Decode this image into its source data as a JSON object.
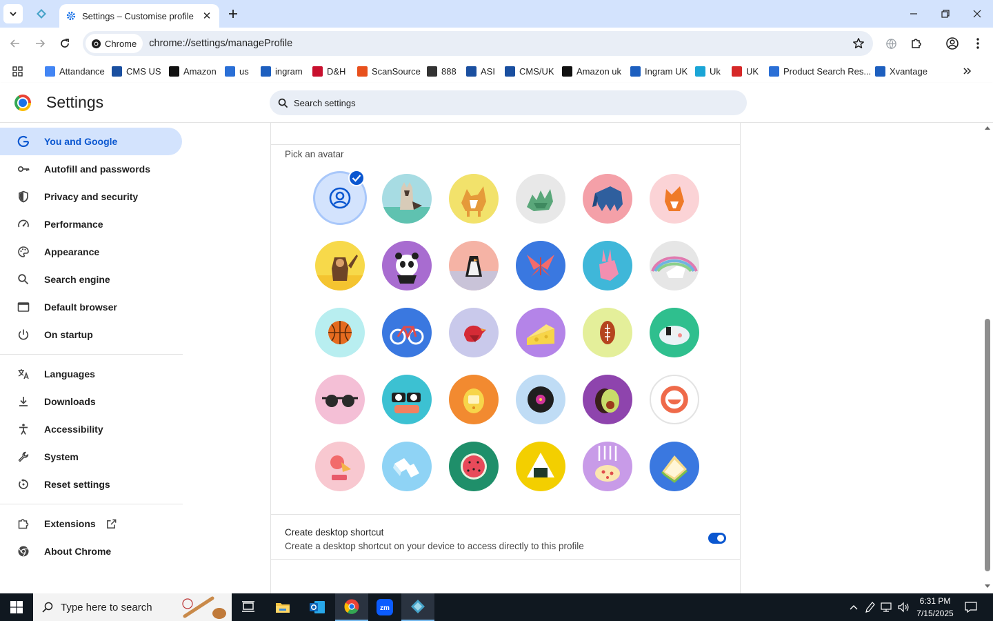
{
  "browser": {
    "tab_title": "Settings – Customise profile",
    "chip_label": "Chrome",
    "url": "chrome://settings/manageProfile"
  },
  "bookmarks": [
    {
      "label": "Attandance",
      "color": "#4285f4"
    },
    {
      "label": "CMS US",
      "color": "#1a4fa0"
    },
    {
      "label": "Amazon",
      "color": "#111111"
    },
    {
      "label": "us",
      "color": "#2a6fd6"
    },
    {
      "label": "ingram",
      "color": "#1d5fbf"
    },
    {
      "label": "D&H",
      "color": "#c8102e"
    },
    {
      "label": "ScanSource",
      "color": "#e8501c"
    },
    {
      "label": "888",
      "color": "#333333"
    },
    {
      "label": "ASI",
      "color": "#1a4fa0"
    },
    {
      "label": "CMS/UK",
      "color": "#1a4fa0"
    },
    {
      "label": "Amazon uk",
      "color": "#111111"
    },
    {
      "label": "Ingram UK",
      "color": "#1d5fbf"
    },
    {
      "label": "Uk",
      "color": "#1aa5d6"
    },
    {
      "label": "UK",
      "color": "#d62828"
    },
    {
      "label": "Product Search Res...",
      "color": "#2a6fd6"
    },
    {
      "label": "Xvantage",
      "color": "#1d5fbf"
    }
  ],
  "settings": {
    "title": "Settings",
    "search_placeholder": "Search settings"
  },
  "sidebar": {
    "items": [
      {
        "label": "You and Google",
        "icon": "google-icon"
      },
      {
        "label": "Autofill and passwords",
        "icon": "key-icon"
      },
      {
        "label": "Privacy and security",
        "icon": "shield-icon"
      },
      {
        "label": "Performance",
        "icon": "speedometer-icon"
      },
      {
        "label": "Appearance",
        "icon": "palette-icon"
      },
      {
        "label": "Search engine",
        "icon": "search-icon"
      },
      {
        "label": "Default browser",
        "icon": "browser-window-icon"
      },
      {
        "label": "On startup",
        "icon": "power-icon"
      },
      {
        "label": "Languages",
        "icon": "translate-icon"
      },
      {
        "label": "Downloads",
        "icon": "download-icon"
      },
      {
        "label": "Accessibility",
        "icon": "accessibility-icon"
      },
      {
        "label": "System",
        "icon": "wrench-icon"
      },
      {
        "label": "Reset settings",
        "icon": "reset-icon"
      },
      {
        "label": "Extensions",
        "icon": "puzzle-icon"
      },
      {
        "label": "About Chrome",
        "icon": "chrome-icon"
      }
    ]
  },
  "profile": {
    "pick_avatar_label": "Pick an avatar",
    "avatars": [
      {
        "name": "generic-person",
        "bg": "#d3e3fd",
        "selected": true
      },
      {
        "name": "cat",
        "bg": "#a7dce3"
      },
      {
        "name": "corgi",
        "bg": "#f2e26b"
      },
      {
        "name": "dragon",
        "bg": "#e8e8e8"
      },
      {
        "name": "elephant",
        "bg": "#f4a0a8"
      },
      {
        "name": "fox",
        "bg": "#fbd3d6"
      },
      {
        "name": "monkey",
        "bg": "#f7d94a"
      },
      {
        "name": "panda",
        "bg": "#a86cd0"
      },
      {
        "name": "penguin",
        "bg": "#f5b3a5"
      },
      {
        "name": "butterfly",
        "bg": "#3a78e0"
      },
      {
        "name": "rabbit",
        "bg": "#3fb7d9"
      },
      {
        "name": "unicorn",
        "bg": "#e6e6e6"
      },
      {
        "name": "basketball",
        "bg": "#b8eef0"
      },
      {
        "name": "bicycle",
        "bg": "#3a78e0"
      },
      {
        "name": "bird",
        "bg": "#c9c9eb"
      },
      {
        "name": "cheese",
        "bg": "#b484e8"
      },
      {
        "name": "football",
        "bg": "#e4ef9a"
      },
      {
        "name": "sushi-plate",
        "bg": "#2fbf8e"
      },
      {
        "name": "sunglasses",
        "bg": "#f4bfd6"
      },
      {
        "name": "sushi",
        "bg": "#3cc1d2"
      },
      {
        "name": "tamagotchi",
        "bg": "#f28a30"
      },
      {
        "name": "vinyl",
        "bg": "#bfdcf5"
      },
      {
        "name": "avocado",
        "bg": "#8e44ad"
      },
      {
        "name": "smiley",
        "bg": "#ffffff"
      },
      {
        "name": "ice-cream",
        "bg": "#f8c8d0"
      },
      {
        "name": "cubes",
        "bg": "#8fd3f5"
      },
      {
        "name": "watermelon",
        "bg": "#1f8f6a"
      },
      {
        "name": "onigiri",
        "bg": "#f3cf00"
      },
      {
        "name": "pizza",
        "bg": "#c89be8"
      },
      {
        "name": "sandwich",
        "bg": "#3a78e0"
      }
    ],
    "shortcut_title": "Create desktop shortcut",
    "shortcut_desc": "Create a desktop shortcut on your device to access directly to this profile",
    "shortcut_enabled": true
  },
  "taskbar": {
    "search_placeholder": "Type here to search",
    "time": "6:31 PM",
    "date": "7/15/2025"
  },
  "colors": {
    "accent": "#0b57d0",
    "tabstrip": "#d3e3fd",
    "taskbar": "#101820"
  }
}
